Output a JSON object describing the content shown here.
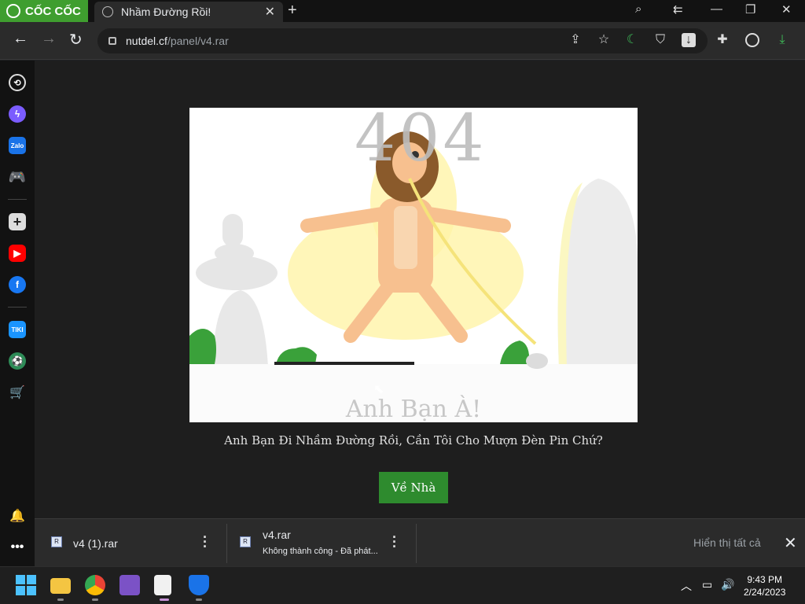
{
  "browser": {
    "brand": "CỐC CỐC",
    "tab_title": "Nhầm Đường Rồi!",
    "url_host": "nutdel.cf",
    "url_path": "/panel/v4.rar"
  },
  "page": {
    "big_text": "404",
    "headline": "Anh Bạn À!",
    "message": "Anh Bạn Đi Nhầm Đường Rồi, Cần Tôi Cho Mượn Đèn Pin Chứ?",
    "home_button": "Về Nhà",
    "button_color": "#2e8b2e"
  },
  "sidebar": {
    "items": [
      {
        "icon": "history-icon"
      },
      {
        "icon": "messenger-icon"
      },
      {
        "icon": "zalo-icon",
        "label": "Zalo"
      },
      {
        "icon": "game-controller-icon"
      },
      {
        "icon": "add-icon"
      },
      {
        "icon": "youtube-icon"
      },
      {
        "icon": "facebook-icon"
      },
      {
        "icon": "tiki-icon",
        "label": "TIKI"
      },
      {
        "icon": "football-icon"
      },
      {
        "icon": "shopping-cart-icon"
      },
      {
        "icon": "bell-icon"
      },
      {
        "icon": "more-icon"
      }
    ]
  },
  "downloads": {
    "items": [
      {
        "name": "v4 (1).rar",
        "status": ""
      },
      {
        "name": "v4.rar",
        "status": "Không thành công - Đã phát..."
      }
    ],
    "show_all": "Hiển thị tất cả"
  },
  "taskbar": {
    "time": "9:43 PM",
    "date": "2/24/2023"
  }
}
